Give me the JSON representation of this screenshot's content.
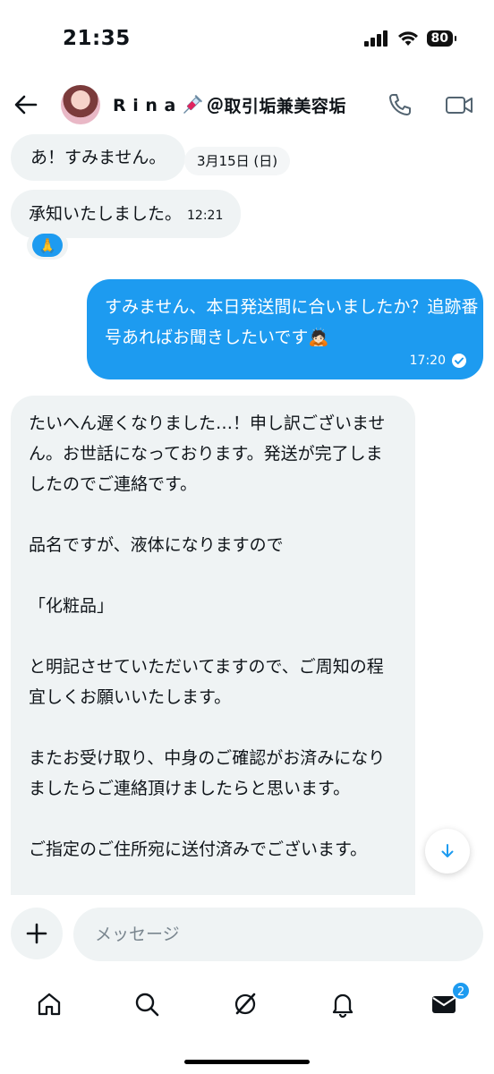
{
  "status_bar": {
    "time": "21:35",
    "battery": "80"
  },
  "header": {
    "name": "R i n a",
    "handle": "＠取引垢兼美容垢"
  },
  "messages": {
    "first": {
      "text": "あ！すみません。"
    },
    "date_separator": "3月15日 (日)",
    "second": {
      "text": "承知いたしました。",
      "time": "12:21"
    },
    "reaction": "🙏",
    "outgoing": {
      "text": "すみません、本日発送間に合いましたか？追跡番号あればお聞きしたいです🙇🏻",
      "time": "17:20"
    },
    "long_incoming": {
      "text": "たいへん遅くなりました…！申し訳ございません。お世話になっております。発送が完了しましたのでご連絡です。\n\n品名ですが、液体になりますので\n\n「化粧品」\n\nと明記させていただいてますので、ご周知の程宜しくお願いいたします。\n\nまたお受け取り、中身のご確認がお済みになりましたらご連絡頂けましたらと思います。\n\nご指定のご住所宛に送付済みでございます。"
    }
  },
  "composer": {
    "placeholder": "メッセージ"
  },
  "tabbar": {
    "messages_badge": "2"
  },
  "colors": {
    "accent": "#1d9bf0",
    "bubble_in": "#eff3f4"
  }
}
